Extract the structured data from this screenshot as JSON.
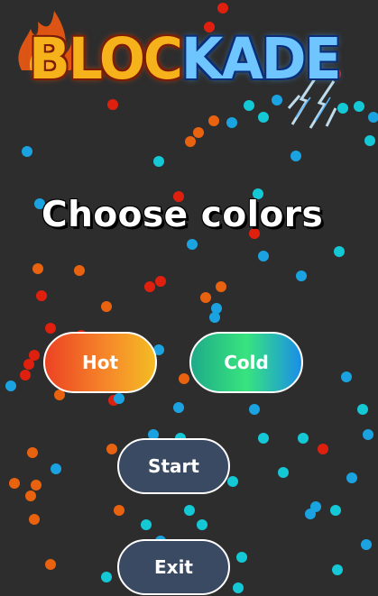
{
  "game": {
    "title_hot": "BLOC",
    "title_cold": "KADE"
  },
  "screen": {
    "heading": "Choose colors"
  },
  "buttons": {
    "hot_label": "Hot",
    "cold_label": "Cold",
    "start_label": "Start",
    "exit_label": "Exit"
  },
  "colors": {
    "background": "#2d2d2d",
    "hot_particle_red": "#e0200f",
    "hot_particle_orange": "#e8620f",
    "cold_particle_blue": "#1aa3e0",
    "cold_particle_cyan": "#14c8d6",
    "menu_button": "#3b4a63"
  },
  "icons": {
    "logo_left": "flame-icon",
    "logo_right": "ice-crystal-icon"
  }
}
